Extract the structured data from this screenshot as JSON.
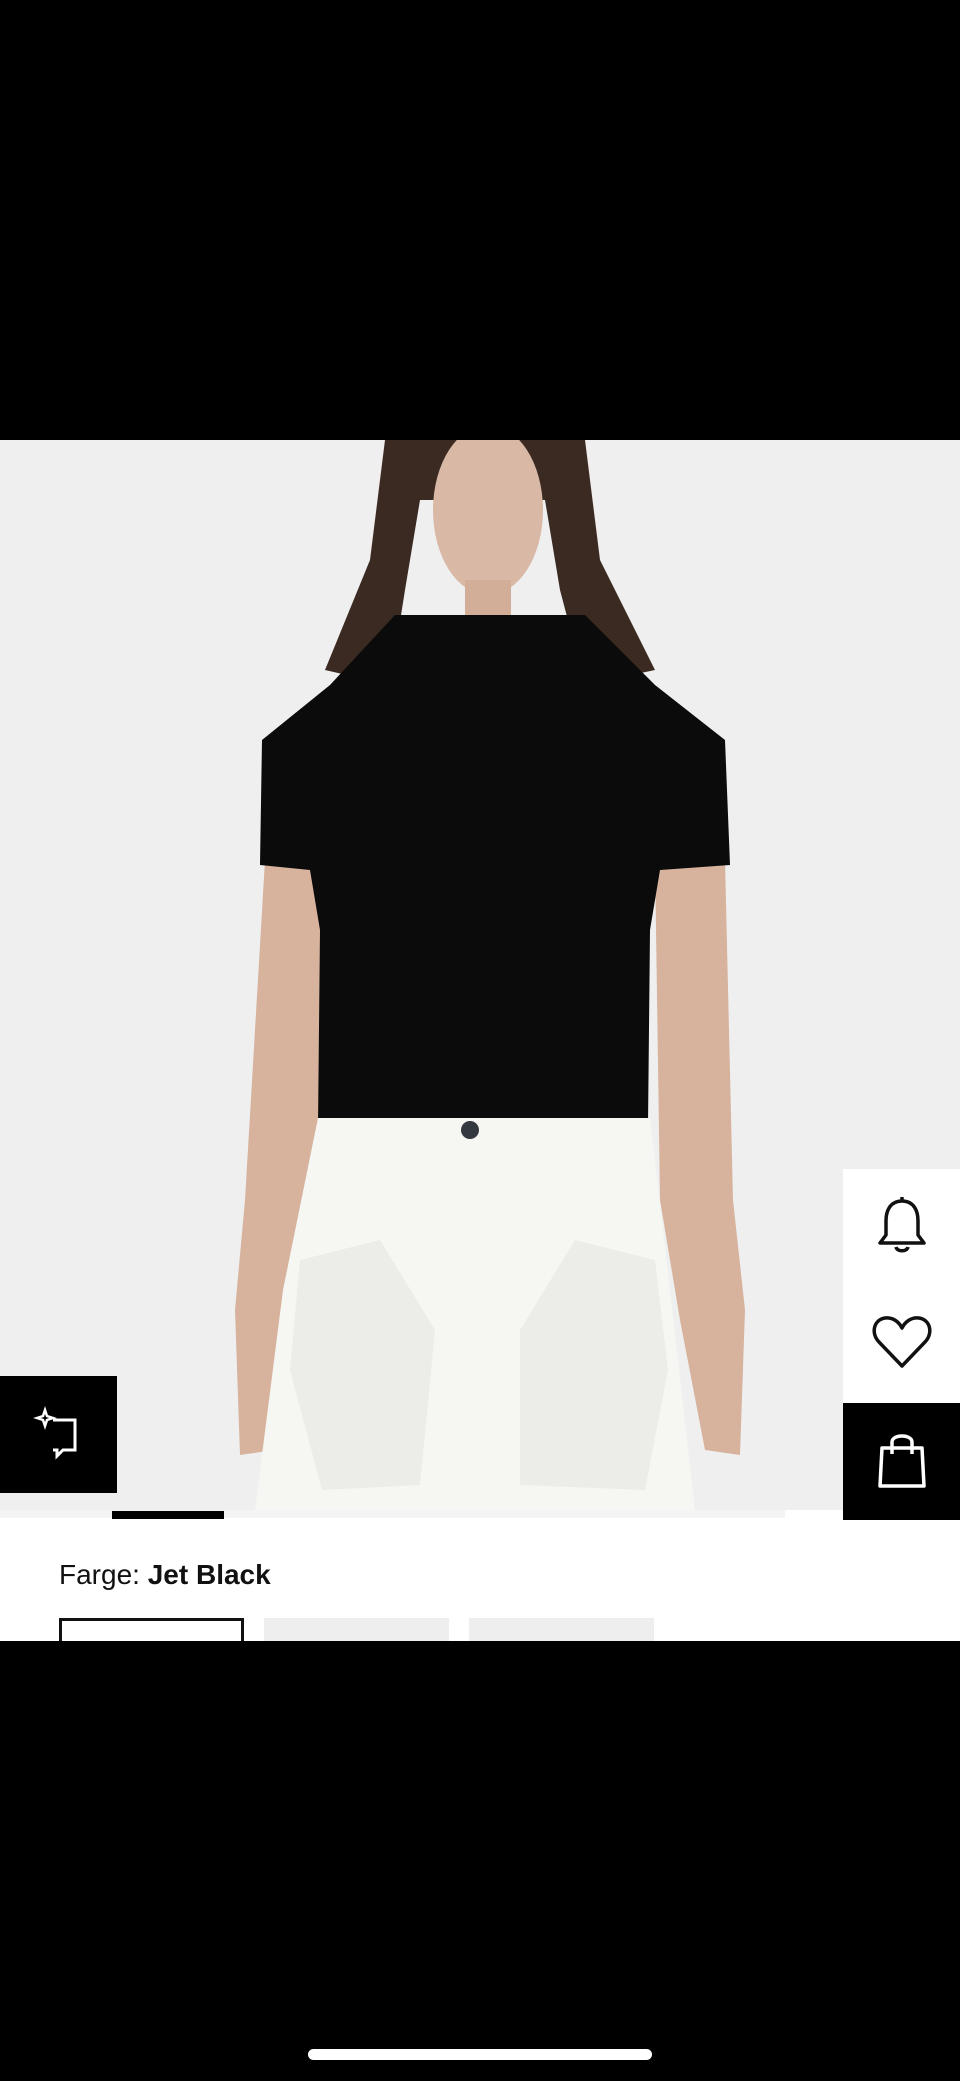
{
  "product": {
    "image_alt": "Model wearing black ribbed short-sleeve mock-neck knit top with white cargo trousers",
    "color_label": "Farge:",
    "color_value": "Jet Black",
    "carousel": {
      "total": 7,
      "active_index": 1
    },
    "swatches": [
      {
        "name": "jet-black",
        "selected": true
      },
      {
        "name": "swatch-2",
        "selected": false
      },
      {
        "name": "swatch-3",
        "selected": false
      }
    ]
  },
  "icons": {
    "similar": "sparkle-frame-icon",
    "notify": "bell-icon",
    "wishlist": "heart-icon",
    "bag": "shopping-bag-icon"
  },
  "colors": {
    "background": "#000000",
    "surface": "#ffffff",
    "image_bg": "#efefef",
    "accent": "#000000"
  }
}
